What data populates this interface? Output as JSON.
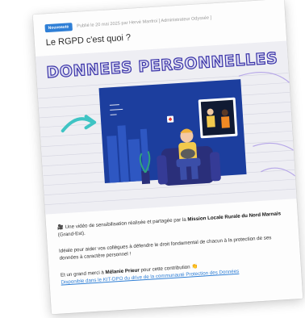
{
  "post": {
    "badge": "Nouveauté",
    "meta": "Publié le 20 mai 2025 par Hervé Manfroi [ Administrateur Odyssée ]",
    "title": "Le RGPD c'est quoi ?"
  },
  "video": {
    "banner": "DONNEES PERSONNELLES"
  },
  "body": {
    "line1_prefix": "Une vidéo de sensibilisation réalisée et partagée par la ",
    "line1_bold": "Mission Locale Rurale du Nord Marnais",
    "line2": "(Grand-Est).",
    "line3": "Idéale pour aider vos collègues à défendre le droit fondamental de chacun à la protection de ses",
    "line4": "données à caractère personnel !",
    "line5_prefix": "Et un grand merci à ",
    "line5_bold": "Mélanie Prieur",
    "line5_suffix": " pour cette contribution",
    "link": "Disponible dans le KIT-DPO du drive de la communauté Protection des Données"
  },
  "colors": {
    "accent": "#2f7fd6",
    "banner_stroke": "#3a33a8",
    "video_bg": "#eeeef3",
    "screen_blue": "#1c3e9e",
    "arrow_teal": "#3fc4c4"
  }
}
